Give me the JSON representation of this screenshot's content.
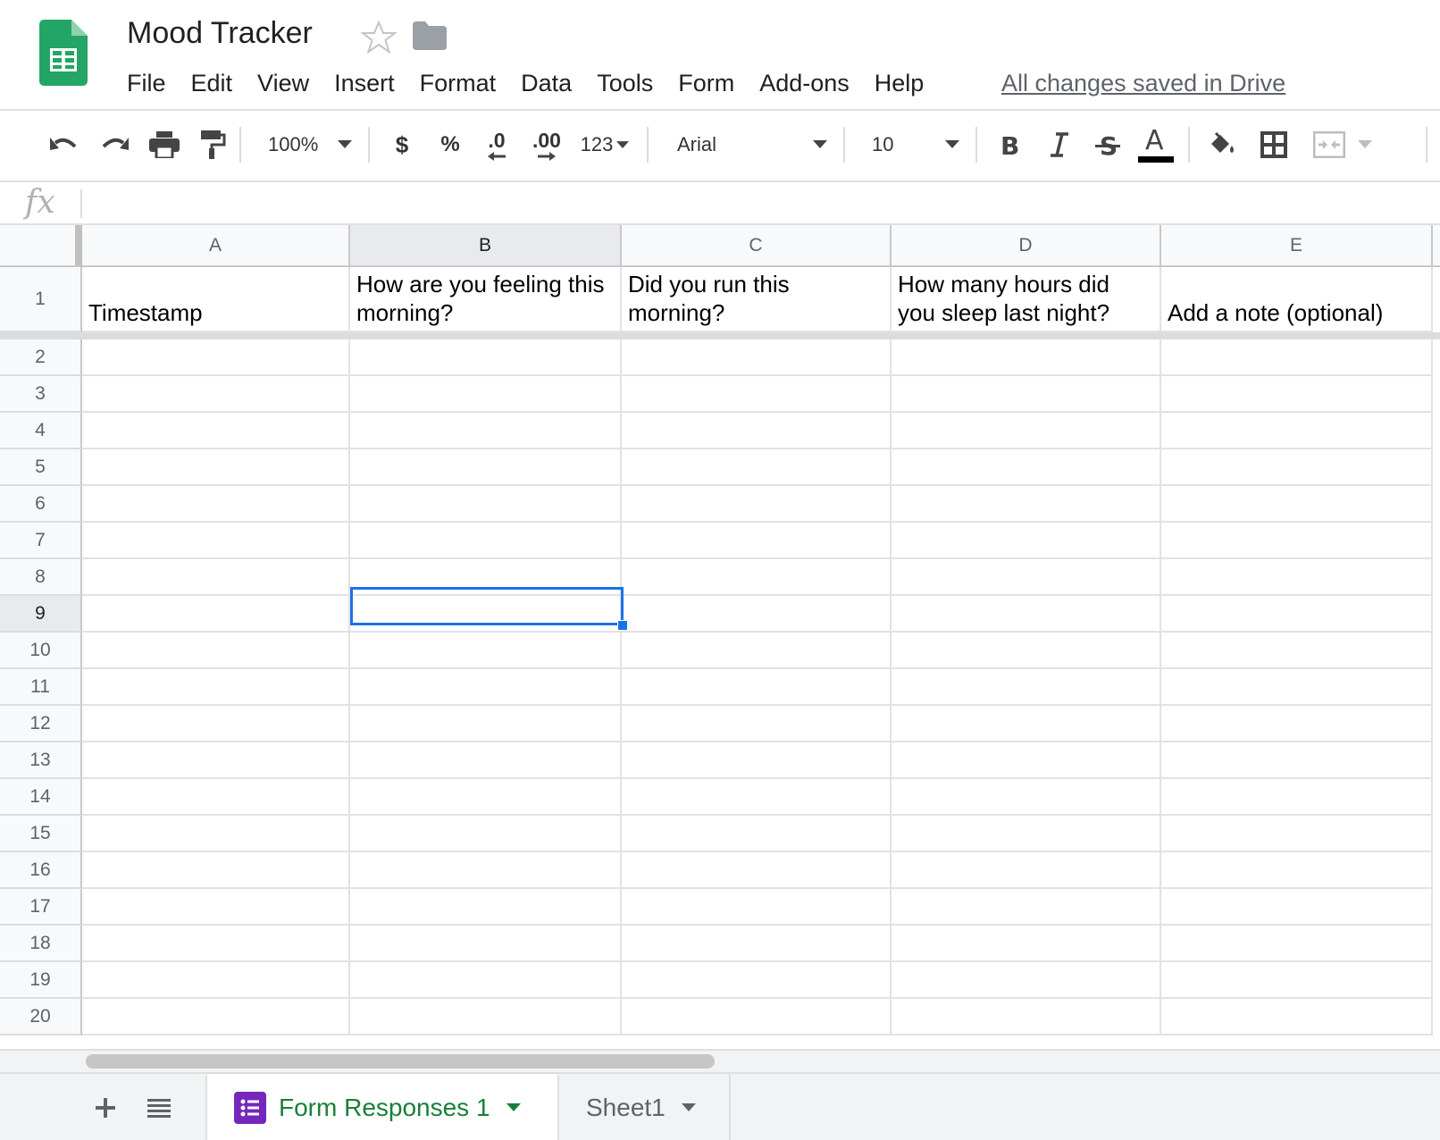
{
  "header": {
    "title": "Mood Tracker",
    "menu": [
      "File",
      "Edit",
      "View",
      "Insert",
      "Format",
      "Data",
      "Tools",
      "Form",
      "Add-ons",
      "Help"
    ],
    "save_status": "All changes saved in Drive"
  },
  "toolbar": {
    "zoom": "100%",
    "currency": "$",
    "percent": "%",
    "decrease_decimal": ".0",
    "increase_decimal": ".00",
    "number_format": "123",
    "font": "Arial",
    "font_size": "10"
  },
  "formula_bar": {
    "fx_label": "fx",
    "value": ""
  },
  "grid": {
    "columns": [
      "A",
      "B",
      "C",
      "D",
      "E"
    ],
    "rows": [
      "1",
      "2",
      "3",
      "4",
      "5",
      "6",
      "7",
      "8",
      "9",
      "10",
      "11",
      "12",
      "13",
      "14",
      "15",
      "16",
      "17",
      "18",
      "19",
      "20"
    ],
    "header_row": [
      "Timestamp",
      "How are you feeling this morning?",
      "Did you run this morning?",
      "How many hours did you sleep last night?",
      "Add a note (optional)"
    ],
    "selected_cell": "B9",
    "active_column": "B",
    "active_row": "9"
  },
  "sheets": [
    {
      "name": "Form Responses 1",
      "active": true
    },
    {
      "name": "Sheet1",
      "active": false
    }
  ],
  "colors": {
    "accent": "#1a73e8",
    "sheets_green": "#0f9d58",
    "forms_purple": "#7627bb",
    "active_tab_text": "#188038"
  }
}
